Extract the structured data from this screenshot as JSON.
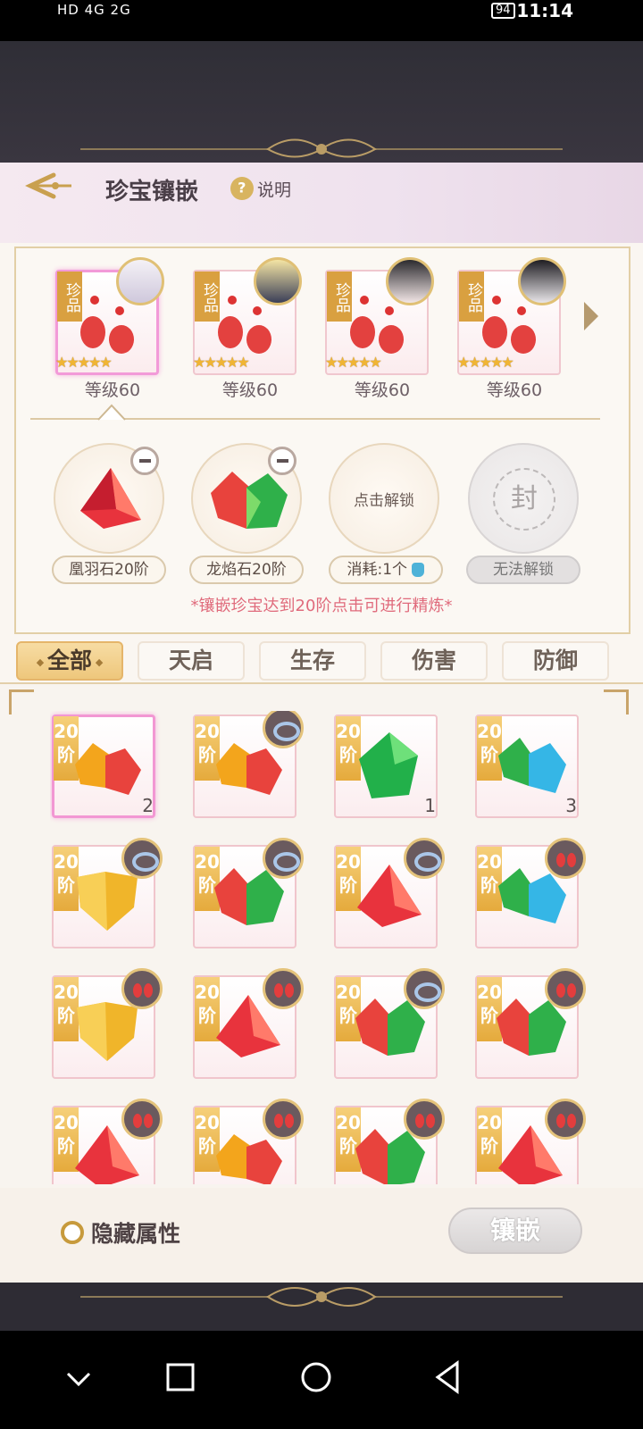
{
  "status_bar": {
    "left": "HD 4G 2G",
    "battery": "94",
    "time": "11:14"
  },
  "header": {
    "title": "珍宝镶嵌",
    "help_label": "说明"
  },
  "characters": [
    {
      "tag": "珍品",
      "level": "等级60",
      "stars": "★★★★★",
      "selected": true
    },
    {
      "tag": "珍品",
      "level": "等级60",
      "stars": "★★★★★",
      "selected": false
    },
    {
      "tag": "珍品",
      "level": "等级60",
      "stars": "★★★★★",
      "selected": false
    },
    {
      "tag": "珍品",
      "level": "等级60",
      "stars": "★★★★★",
      "selected": false
    }
  ],
  "slots": [
    {
      "label": "凰羽石20阶",
      "state": "filled"
    },
    {
      "label": "龙焰石20阶",
      "state": "filled"
    },
    {
      "label": "消耗:1个",
      "state": "unlockable",
      "center_text": "点击解锁"
    },
    {
      "label": "无法解锁",
      "state": "sealed",
      "center_text": "封"
    }
  ],
  "notice": "*镶嵌珍宝达到20阶点击可进行精炼*",
  "tabs": [
    "全部",
    "天启",
    "生存",
    "伤害",
    "防御"
  ],
  "active_tab": "全部",
  "gem_rank_label": "20阶",
  "gems": [
    {
      "count": "2",
      "selected": true
    },
    {
      "count": ""
    },
    {
      "count": "1"
    },
    {
      "count": "3"
    }
  ],
  "hide_attr_label": "隐藏属性",
  "embed_button": "镶嵌",
  "colors": {
    "accent_gold": "#e5aa3c",
    "pink_select": "#f29ad8",
    "notice_red": "#e06b7c"
  }
}
